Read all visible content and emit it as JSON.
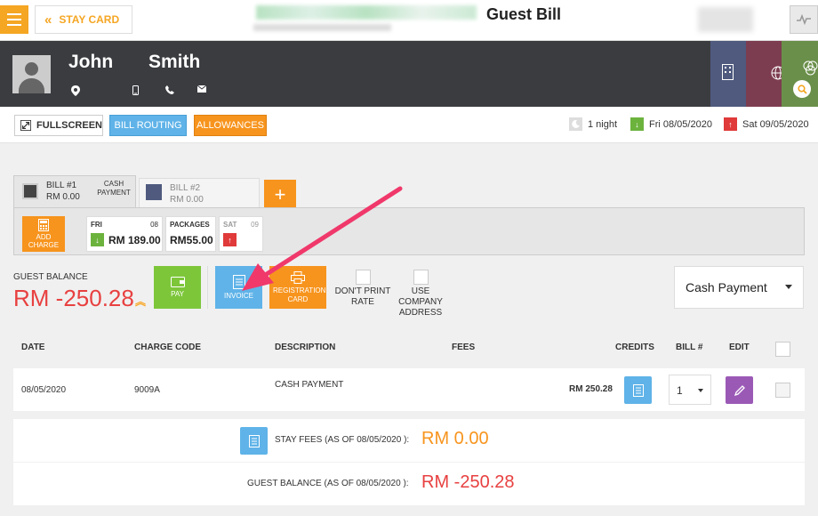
{
  "header": {
    "back_label": "STAY CARD",
    "title": "Guest Bill"
  },
  "guest": {
    "first_name": "John",
    "last_name": "Smith"
  },
  "toolbar": {
    "fullscreen_label": "FULLSCREEN",
    "bill_routing_label": "BILL ROUTING",
    "allowances_label": "ALLOWANCES",
    "nights": "1 night",
    "arrival": "Fri 08/05/2020",
    "departure": "Sat 09/05/2020"
  },
  "bills": [
    {
      "name": "BILL #1",
      "amount": "RM 0.00",
      "type": "CASH PAYMENT"
    },
    {
      "name": "BILL #2",
      "amount": "RM 0.00"
    }
  ],
  "add_bill_label": "+",
  "add_charge_label": "ADD CHARGE",
  "days": [
    {
      "day": "FRI",
      "date": "08",
      "amount": "RM 189.00"
    },
    {
      "day": "PACKAGES",
      "date": "",
      "amount": "RM55.00"
    },
    {
      "day": "SAT",
      "date": "09",
      "amount": ""
    }
  ],
  "balance": {
    "label": "GUEST BALANCE",
    "value": "RM -250.28"
  },
  "actions": {
    "pay": "PAY",
    "invoice": "INVOICE",
    "registration_card": "REGISTRATION CARD",
    "dont_print_rate": "DON'T PRINT RATE",
    "use_company_address": "USE COMPANY ADDRESS",
    "payment_method": "Cash Payment"
  },
  "table": {
    "headers": {
      "date": "DATE",
      "charge_code": "CHARGE CODE",
      "description": "DESCRIPTION",
      "fees": "FEES",
      "credits": "CREDITS",
      "bill": "BILL #",
      "edit": "EDIT"
    },
    "rows": [
      {
        "date": "08/05/2020",
        "charge_code": "9009A",
        "description": "CASH PAYMENT",
        "fees": "",
        "credits": "RM 250.28",
        "bill": "1"
      }
    ]
  },
  "summary": {
    "stay_fees_label": "STAY FEES (AS OF  08/05/2020 ):",
    "stay_fees_value": "RM 0.00",
    "guest_balance_label": "GUEST BALANCE (AS OF  08/05/2020 ):",
    "guest_balance_value": "RM -250.28"
  },
  "colors": {
    "orange": "#f7941d",
    "blue": "#5fb3e8",
    "green": "#7dc63a",
    "red": "#e84040",
    "dark": "#3a3c40",
    "annotation_arrow": "#f0386b"
  }
}
